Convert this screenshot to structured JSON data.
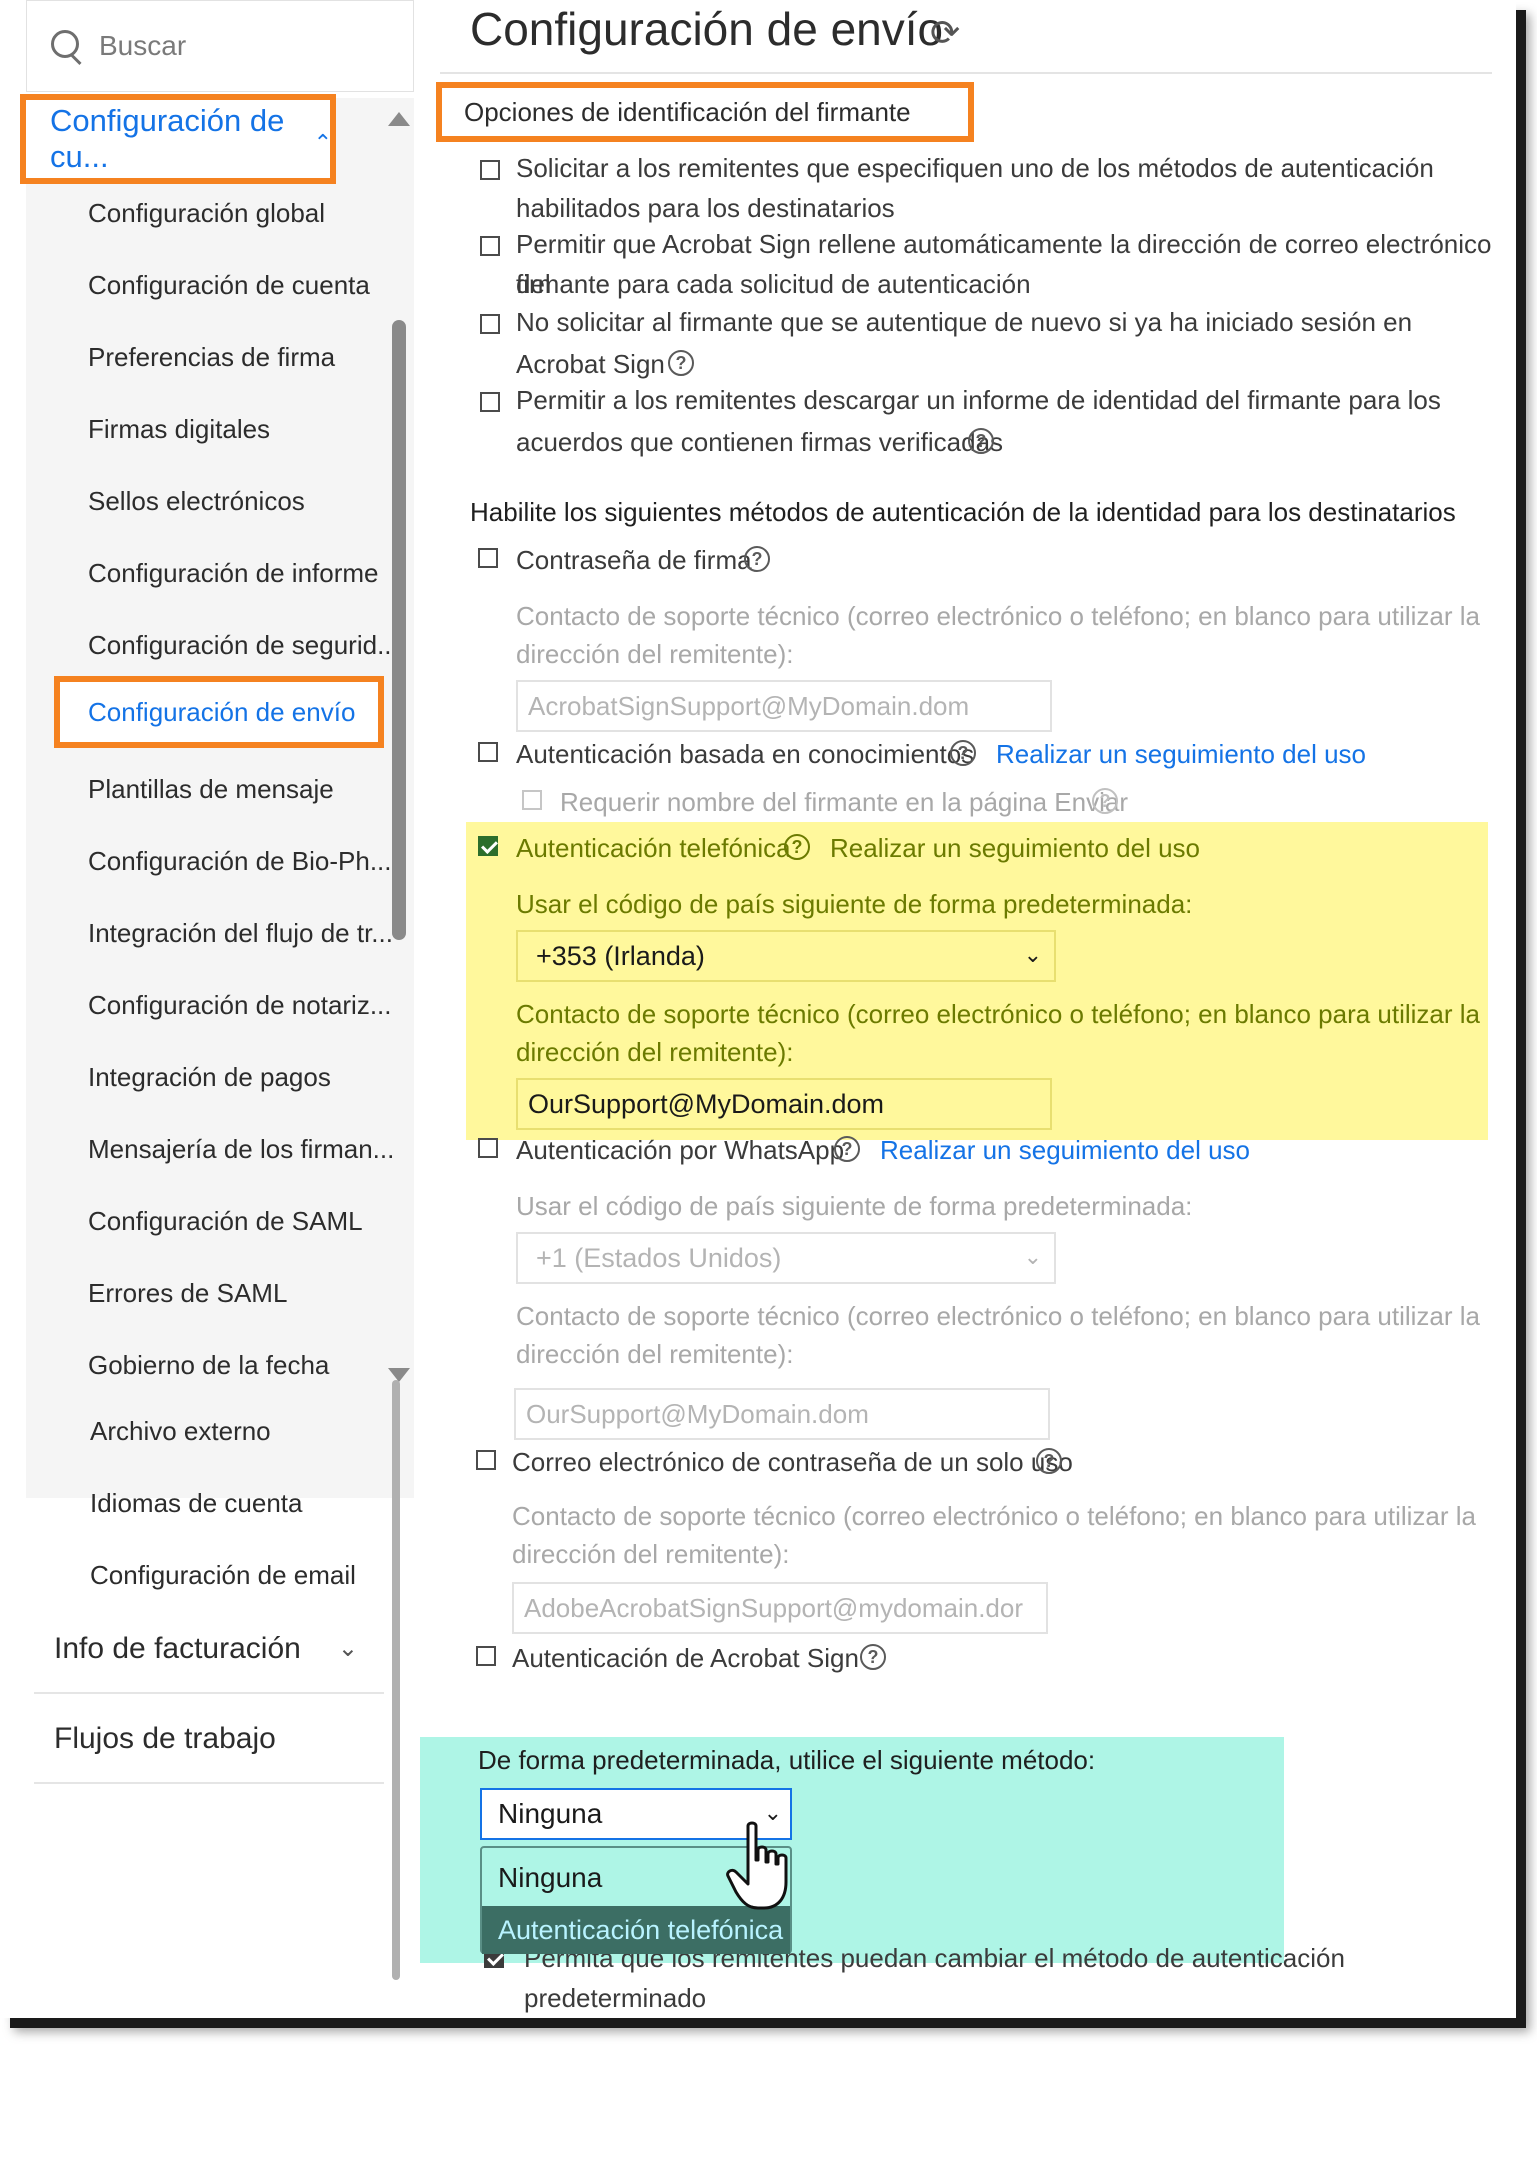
{
  "search": {
    "placeholder": "Buscar"
  },
  "nav": {
    "head_label": "Configuración de cu...",
    "items": [
      "Configuración global",
      "Configuración de cuenta",
      "Preferencias de firma",
      "Firmas digitales",
      "Sellos electrónicos",
      "Configuración de informe",
      "Configuración de segurid...",
      "Configuración de envío",
      "Plantillas de mensaje",
      "Configuración de Bio-Ph...",
      "Integración del flujo de tr...",
      "Configuración de notariz...",
      "Integración de pagos",
      "Mensajería de los firman...",
      "Configuración de SAML",
      "Errores de SAML",
      "Gobierno de la fecha",
      "Archivo externo",
      "Idiomas de cuenta",
      "Configuración de email"
    ],
    "sections": [
      "Info de facturación",
      "Flujos de trabajo"
    ]
  },
  "main": {
    "title": "Configuración de envío",
    "section_title": "Opciones de identificación del firmante",
    "options": [
      {
        "line1": "Solicitar a los remitentes que especifiquen uno de los métodos de autenticación",
        "line2": "habilitados para los destinatarios"
      },
      {
        "line1": "Permitir que Acrobat Sign rellene automáticamente la dirección de correo electrónico del",
        "line2": "firmante para cada solicitud de autenticación"
      },
      {
        "line1": "No solicitar al firmante que se autentique de nuevo si ya ha iniciado sesión en",
        "line2": "Acrobat Sign"
      },
      {
        "line1": "Permitir a los remitentes descargar un informe de identidad del firmante para los",
        "line2": "acuerdos que contienen firmas verificadas"
      }
    ],
    "methods_heading": "Habilite los siguientes métodos de autenticación de la identidad para los destinatarios",
    "password": {
      "label": "Contraseña de firma",
      "contact_line1": "Contacto de soporte técnico (correo electrónico o teléfono; en blanco para utilizar la",
      "contact_line2": "dirección del remitente):",
      "value": "AcrobatSignSupport@MyDomain.dom"
    },
    "kba": {
      "label": "Autenticación basada en conocimientos",
      "link": "Realizar un seguimiento del uso",
      "sub_label": "Requerir nombre del firmante en la página Enviar"
    },
    "phone": {
      "label": "Autenticación telefónica",
      "link": "Realizar un seguimiento del uso",
      "country_label": "Usar el código de país siguiente de forma predeterminada:",
      "country_value": "+353 (Irlanda)",
      "contact_line1": "Contacto de soporte técnico (correo electrónico o teléfono; en blanco para utilizar la",
      "contact_line2": "dirección del remitente):",
      "value": "OurSupport@MyDomain.dom"
    },
    "whatsapp": {
      "label": "Autenticación por WhatsApp",
      "link": "Realizar un seguimiento del uso",
      "country_label": "Usar el código de país siguiente de forma predeterminada:",
      "country_value": "+1 (Estados Unidos)",
      "contact_line1": "Contacto de soporte técnico (correo electrónico o teléfono; en blanco para utilizar la",
      "contact_line2": "dirección del remitente):",
      "value": "OurSupport@MyDomain.dom"
    },
    "otp": {
      "label": "Correo electrónico de contraseña de un solo uso",
      "contact_line1": "Contacto de soporte técnico (correo electrónico o teléfono; en blanco para utilizar la",
      "contact_line2": "dirección del remitente):",
      "value": "AdobeAcrobatSignSupport@mydomain.dor"
    },
    "acrobat": {
      "label": "Autenticación de Acrobat Sign"
    },
    "default_method": {
      "label": "De forma predeterminada, utilice el siguiente método:",
      "selected": "Ninguna",
      "options": [
        "Ninguna",
        "Autenticación telefónica"
      ]
    },
    "allow_change": "Permita que los remitentes puedan cambiar el método de autenticación predeterminado"
  },
  "colors": {
    "accent": "#1473e6",
    "highlight_orange": "#f58220",
    "highlight_yellow": "#fff89c",
    "highlight_cyan": "#aef5e6"
  }
}
